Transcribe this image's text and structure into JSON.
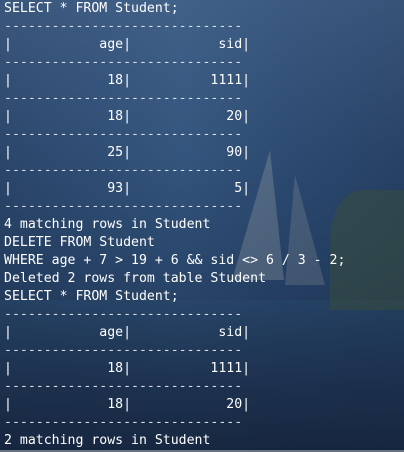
{
  "terminal": {
    "lines": [
      {
        "text": "SELECT * FROM Student;",
        "kind": "command"
      },
      {
        "text": "------------------------------",
        "kind": "rule"
      },
      {
        "text": "|           age|           sid|",
        "kind": "header"
      },
      {
        "text": "------------------------------",
        "kind": "rule"
      },
      {
        "text": "|            18|          1111|",
        "kind": "row"
      },
      {
        "text": "------------------------------",
        "kind": "rule"
      },
      {
        "text": "|            18|            20|",
        "kind": "row"
      },
      {
        "text": "------------------------------",
        "kind": "rule"
      },
      {
        "text": "|            25|            90|",
        "kind": "row"
      },
      {
        "text": "------------------------------",
        "kind": "rule"
      },
      {
        "text": "|            93|             5|",
        "kind": "row"
      },
      {
        "text": "------------------------------",
        "kind": "rule"
      },
      {
        "text": "4 matching rows in Student",
        "kind": "status"
      },
      {
        "text": "DELETE FROM Student",
        "kind": "command"
      },
      {
        "text": "WHERE age + 7 > 19 + 6 && sid <> 6 / 3 - 2;",
        "kind": "command"
      },
      {
        "text": "Deleted 2 rows from table Student",
        "kind": "status"
      },
      {
        "text": "SELECT * FROM Student;",
        "kind": "command"
      },
      {
        "text": "------------------------------",
        "kind": "rule"
      },
      {
        "text": "|           age|           sid|",
        "kind": "header"
      },
      {
        "text": "------------------------------",
        "kind": "rule"
      },
      {
        "text": "|            18|          1111|",
        "kind": "row"
      },
      {
        "text": "------------------------------",
        "kind": "rule"
      },
      {
        "text": "|            18|            20|",
        "kind": "row"
      },
      {
        "text": "------------------------------",
        "kind": "rule"
      },
      {
        "text": "2 matching rows in Student",
        "kind": "status"
      }
    ]
  },
  "colors": {
    "text": "#ffffff",
    "rule": "#d8dde6",
    "background": "#2c4668"
  }
}
